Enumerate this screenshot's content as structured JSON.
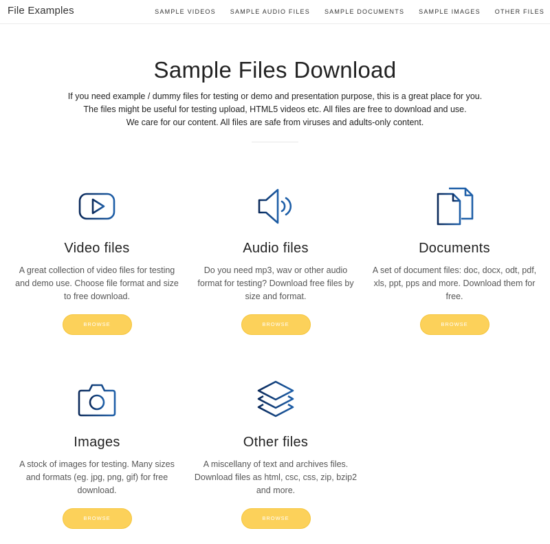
{
  "brand": "File Examples",
  "nav": [
    "SAMPLE VIDEOS",
    "SAMPLE AUDIO FILES",
    "SAMPLE DOCUMENTS",
    "SAMPLE IMAGES",
    "OTHER FILES"
  ],
  "hero": {
    "title": "Sample Files Download",
    "lines": [
      "If you need example / dummy files for testing or demo and presentation purpose, this is a great place for you.",
      "The files might be useful for testing upload, HTML5 videos etc. All files are free to download and use.",
      "We care for our content. All files are safe from viruses and adults-only content."
    ]
  },
  "colors": {
    "accent": "#fcd15a",
    "icon_dark": "#0b2a5b",
    "icon_blue": "#1e5fa8"
  },
  "cards": [
    {
      "icon": "video-icon",
      "title": "Video files",
      "description": "A great collection of video files for testing and demo use. Choose file format and size to free download.",
      "button": "BROWSE"
    },
    {
      "icon": "audio-icon",
      "title": "Audio files",
      "description": "Do you need mp3, wav or other audio format for testing? Download free files by size and format.",
      "button": "BROWSE"
    },
    {
      "icon": "document-icon",
      "title": "Documents",
      "description": "A set of document files: doc, docx, odt, pdf, xls, ppt, pps and more. Download them for free.",
      "button": "BROWSE"
    },
    {
      "icon": "camera-icon",
      "title": "Images",
      "description": "A stock of images for testing. Many sizes and formats (eg. jpg, png, gif) for free download.",
      "button": "BROWSE"
    },
    {
      "icon": "layers-icon",
      "title": "Other files",
      "description": "A miscellany of text and archives files. Download files as html, csc, css, zip, bzip2 and more.",
      "button": "BROWSE"
    }
  ]
}
